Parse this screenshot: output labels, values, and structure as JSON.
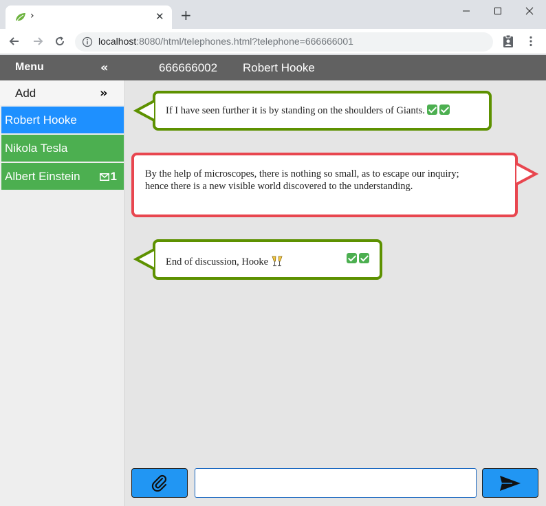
{
  "browser": {
    "tab_title": "›",
    "tab_close": "✕",
    "new_tab": "+",
    "url_host": "localhost",
    "url_rest": ":8080/html/telephones.html?telephone=666666001"
  },
  "header": {
    "menu_label": "Menu",
    "collapse_icon": "«",
    "current_phone": "666666002",
    "current_name": "Robert Hooke"
  },
  "sidebar": {
    "add_label": "Add",
    "expand_icon": "»",
    "contacts": [
      {
        "name": "Robert Hooke",
        "color": "#1e90ff",
        "badge": ""
      },
      {
        "name": "Nikola Tesla",
        "color": "#4caf50",
        "badge": ""
      },
      {
        "name": "Albert Einstein",
        "color": "#4caf50",
        "badge": "1"
      }
    ]
  },
  "messages": [
    {
      "direction": "in",
      "text": "If I have seen further it is by standing on the shoulders of Giants.",
      "status_icons": [
        "check-icon",
        "check-icon"
      ]
    },
    {
      "direction": "out",
      "text": "By the help of microscopes, there is nothing so small, as to escape our inquiry; hence there is a new visible world discovered to the understanding.",
      "status_icons": []
    },
    {
      "direction": "in",
      "text": "End of discussion, Hooke",
      "emoji": "🥂",
      "status_icons": [
        "check-icon",
        "check-icon"
      ]
    }
  ],
  "composer": {
    "input_value": "",
    "attach_icon": "paperclip-icon",
    "send_icon": "send-icon"
  },
  "colors": {
    "incoming_border": "#5d9100",
    "outgoing_border": "#e8464f",
    "header_bg": "#616161",
    "button_blue": "#2196f3"
  }
}
